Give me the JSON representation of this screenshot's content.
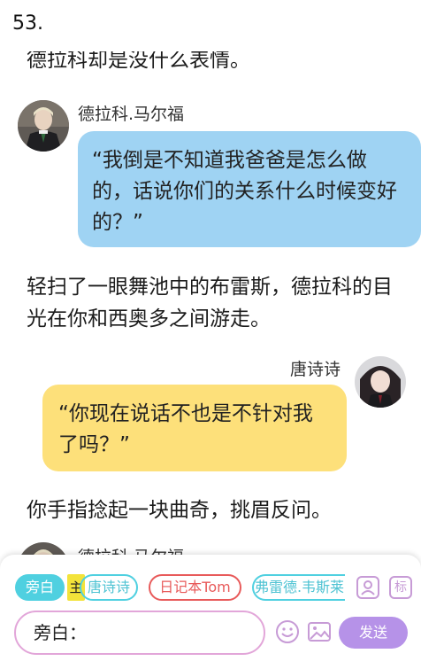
{
  "header": {
    "title": "53."
  },
  "story": {
    "narration_top": "德拉科却是没什么表情。",
    "message1": {
      "speaker": "德拉科.马尔福",
      "text": "“我倒是不知道我爸爸是怎么做的，话说你们的关系什么时候变好的？”"
    },
    "narration_middle": "轻扫了一眼舞池中的布雷斯，德拉科的目光在你和西奥多之间游走。",
    "message2": {
      "speaker": "唐诗诗",
      "text": "“你现在说话不也是不针对我了吗？”"
    },
    "narration_bottom": "你手指捻起一块曲奇，挑眉反问。",
    "partial_name": "德拉科.马尔福"
  },
  "compose": {
    "roles": [
      {
        "label": "旁白",
        "selected": true
      },
      {
        "label": "主",
        "is_tag": true
      },
      {
        "label": "唐诗诗"
      },
      {
        "label": "日记本Tom"
      },
      {
        "label": "弗雷德.韦斯莱"
      }
    ],
    "tool1_icon": "person-card-icon",
    "tool2_label": "标",
    "input_value": "旁白：",
    "emoji_icon": "smiley-icon",
    "image_icon": "image-icon",
    "send_label": "发送",
    "colors": {
      "blue_bubble": "#9fd3f3",
      "yellow_bubble": "#fde07a",
      "accent_purple": "#b692e8",
      "chip_cyan": "#4fd0e0",
      "chip_red": "#e85a5a"
    }
  }
}
